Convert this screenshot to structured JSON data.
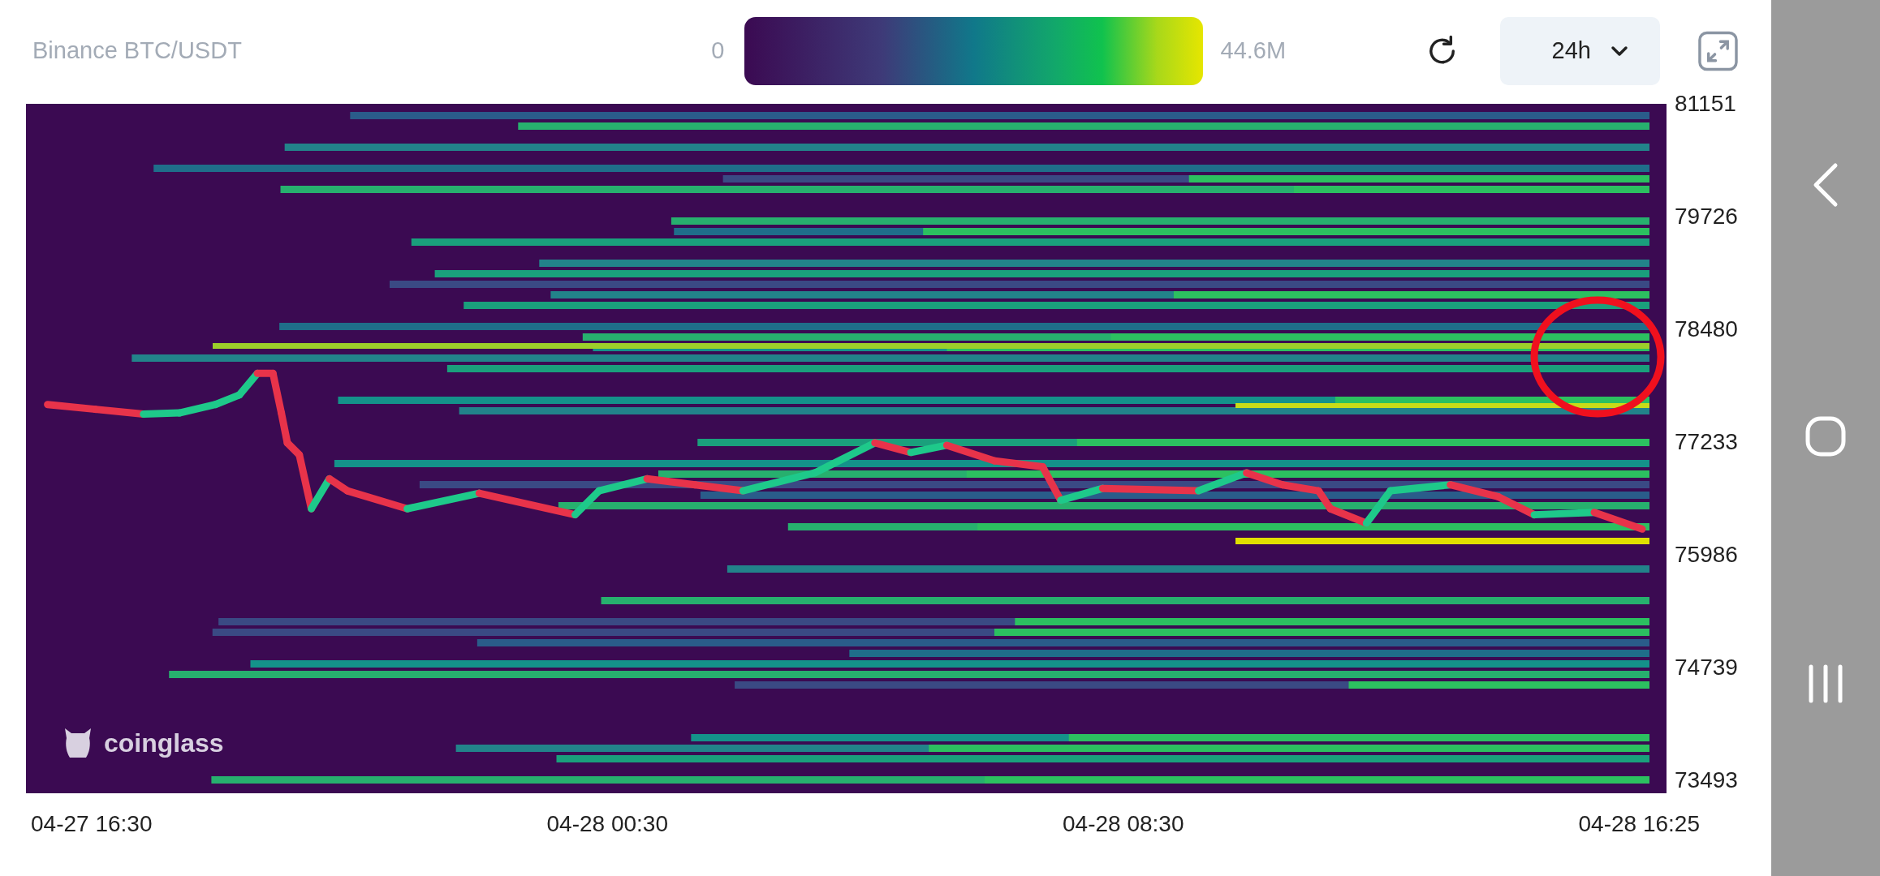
{
  "header": {
    "pair": "Binance BTC/USDT",
    "scale_min": "0",
    "scale_max": "44.6M",
    "interval": "24h"
  },
  "chart": {
    "brand": "coinglass",
    "y_labels": [
      "81151",
      "79726",
      "78480",
      "77233",
      "75986",
      "74739",
      "73493"
    ],
    "x_labels": [
      "04-27 16:30",
      "04-28 00:30",
      "04-28 08:30",
      "04-28 16:25"
    ]
  }
}
